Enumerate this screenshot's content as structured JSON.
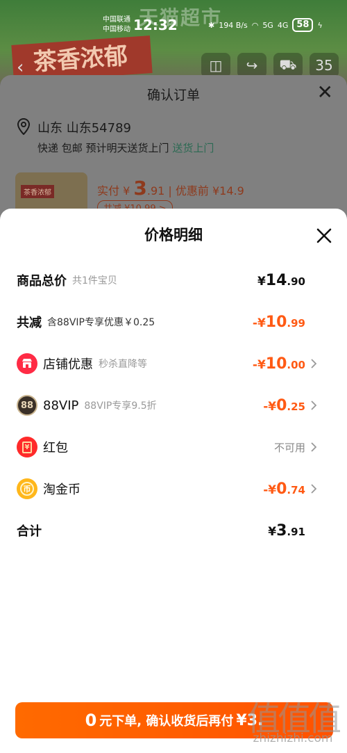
{
  "status_bar": {
    "carrier_1": "中国联通",
    "carrier_2": "中国移动",
    "time": "12:32",
    "net_speed": "194 B/s",
    "signal_1": "5G",
    "signal_2": "4G",
    "battery": "58"
  },
  "background_page": {
    "store_name": "天猫超市",
    "promo_text": "茶香浓郁",
    "cart_count": "35"
  },
  "confirm_order": {
    "title": "确认订单",
    "address": "山东 山东54789",
    "shipping_prefix": "快递 包邮 预计明天送货上门",
    "shipping_tag": "送货上门",
    "product_img_text": "茶香浓郁",
    "actual_label": "实付",
    "actual_currency": "¥",
    "actual_int": "3",
    "actual_dec": ".91",
    "before_discount": "| 优惠前 ¥14.9",
    "saved_chip": "共减 ¥10.99 >"
  },
  "price_detail": {
    "title": "价格明细",
    "rows": [
      {
        "label": "商品总价",
        "note": "共1件宝贝",
        "cur": "¥",
        "int": "14",
        "dec": ".90"
      },
      {
        "label": "共减",
        "note": "含88VIP专享优惠￥0.25",
        "cur": "-¥",
        "int": "10",
        "dec": ".99"
      },
      {
        "label": "店铺优惠",
        "note": "秒杀直降等",
        "cur": "-¥",
        "int": "10",
        "dec": ".00"
      },
      {
        "label": "88VIP",
        "note": "88VIP专享9.5折",
        "cur": "-¥",
        "int": "0",
        "dec": ".25"
      },
      {
        "label": "红包",
        "note": "",
        "value": "不可用"
      },
      {
        "label": "淘金币",
        "note": "",
        "cur": "-¥",
        "int": "0",
        "dec": ".74"
      },
      {
        "label": "合计",
        "note": "",
        "cur": "¥",
        "int": "3",
        "dec": ".91"
      }
    ],
    "icon_88": "88",
    "icon_hongbao": "¥",
    "icon_coin": "币"
  },
  "bottom_bar": {
    "lead": "0",
    "text": "元下单, 确认收货后再付",
    "tail": "¥3."
  },
  "watermark": {
    "glyphs": "值值值",
    "url": "zhizhizhi.com"
  },
  "colors": {
    "accent_orange": "#ff5a14",
    "button_orange": "#ff6a00",
    "store_red": "#ff2b45",
    "vip_dark": "#3a3028",
    "hongbao_red": "#ff2a2a",
    "coin_gold": "#ffb71b"
  }
}
